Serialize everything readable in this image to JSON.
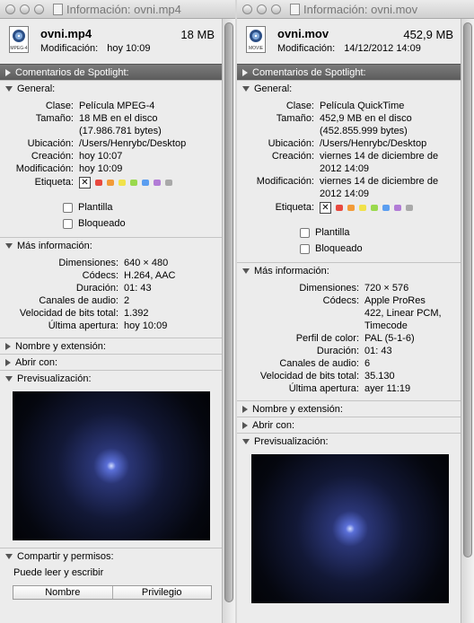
{
  "left": {
    "title": "Información: ovni.mp4",
    "icon_caption": "MPEG-4",
    "file_name": "ovni.mp4",
    "file_size": "18 MB",
    "mod_label": "Modificación:",
    "mod_value": "hoy 10:09",
    "sections": {
      "spotlight": "Comentarios de Spotlight:",
      "general": "General:",
      "more": "Más información:",
      "name_ext": "Nombre y extensión:",
      "open_with": "Abrir con:",
      "preview": "Previsualización:",
      "sharing": "Compartir y permisos:"
    },
    "general": {
      "kind_label": "Clase:",
      "kind": "Película MPEG-4",
      "size_label": "Tamaño:",
      "size1": "18 MB en el disco",
      "size2": "(17.986.781 bytes)",
      "where_label": "Ubicación:",
      "where": "/Users/Henrybc/Desktop",
      "created_label": "Creación:",
      "created": "hoy 10:07",
      "modified_label": "Modificación:",
      "modified": "hoy 10:09",
      "tag_label": "Etiqueta:",
      "template_label": "Plantilla",
      "locked_label": "Bloqueado"
    },
    "more": [
      {
        "label": "Dimensiones:",
        "value": "640 × 480"
      },
      {
        "label": "Códecs:",
        "value": "H.264, AAC"
      },
      {
        "label": "Duración:",
        "value": "01: 43"
      },
      {
        "label": "Canales de audio:",
        "value": "2"
      },
      {
        "label": "Velocidad de bits total:",
        "value": "1.392"
      },
      {
        "label": "Última apertura:",
        "value": "hoy 10:09"
      }
    ],
    "permission_text": "Puede leer y escribir",
    "perm_headers": [
      "Nombre",
      "Privilegio"
    ]
  },
  "right": {
    "title": "Información: ovni.mov",
    "icon_caption": "MOVIE",
    "file_name": "ovni.mov",
    "file_size": "452,9 MB",
    "mod_label": "Modificación:",
    "mod_value": "14/12/2012 14:09",
    "sections": {
      "spotlight": "Comentarios de Spotlight:",
      "general": "General:",
      "more": "Más información:",
      "name_ext": "Nombre y extensión:",
      "open_with": "Abrir con:",
      "preview": "Previsualización:"
    },
    "general": {
      "kind_label": "Clase:",
      "kind": "Película QuickTime",
      "size_label": "Tamaño:",
      "size1": "452,9 MB en el disco",
      "size2": "(452.855.999 bytes)",
      "where_label": "Ubicación:",
      "where": "/Users/Henrybc/Desktop",
      "created_label": "Creación:",
      "created1": "viernes 14 de diciembre de",
      "created2": "2012 14:09",
      "modified_label": "Modificación:",
      "modified1": "viernes 14 de diciembre de",
      "modified2": "2012 14:09",
      "tag_label": "Etiqueta:",
      "template_label": "Plantilla",
      "locked_label": "Bloqueado"
    },
    "more": [
      {
        "label": "Dimensiones:",
        "value": "720 × 576"
      },
      {
        "label": "Códecs:",
        "value": "Apple ProRes"
      },
      {
        "label": "",
        "value": "422, Linear PCM,"
      },
      {
        "label": "",
        "value": "Timecode"
      },
      {
        "label": "Perfil de color:",
        "value": "PAL (5-1-6)"
      },
      {
        "label": "Duración:",
        "value": "01: 43"
      },
      {
        "label": "Canales de audio:",
        "value": "6"
      },
      {
        "label": "Velocidad de bits total:",
        "value": "35.130"
      },
      {
        "label": "Última apertura:",
        "value": "ayer 11:19"
      }
    ]
  },
  "tag_colors": [
    "#e8493f",
    "#f29b38",
    "#f1e24a",
    "#9ad94d",
    "#5b9ef0",
    "#b27cd6",
    "#a9a9a9"
  ],
  "tag_x": "✕"
}
